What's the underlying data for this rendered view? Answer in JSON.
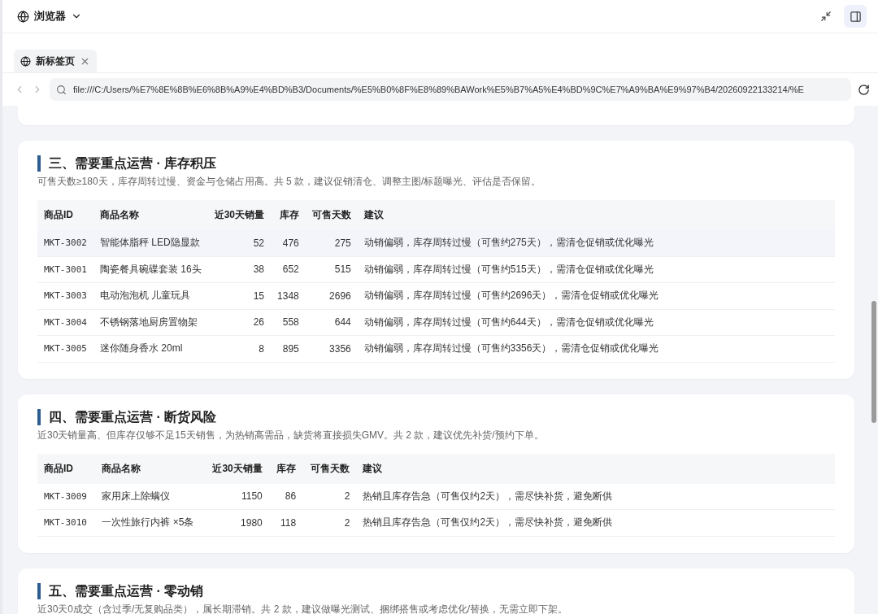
{
  "app": {
    "title": "浏览器"
  },
  "tabs": [
    {
      "label": "新标签页",
      "selected": true
    }
  ],
  "address_bar": {
    "value": "file:///C:/Users/%E7%8E%8B%E6%8B%A9%E4%BD%B3/Documents/%E5%B0%8F%E8%89%BAWork%E5%B7%A5%E4%BD%9C%E7%A9%BA%E9%97%B4/20260922133214/%E"
  },
  "sections": [
    {
      "title": "三、需要重点运营 · 库存积压",
      "description": "可售天数≥180天，库存周转过慢、资金与仓储占用高。共 5 款，建议促销清仓、调整主图/标题曝光、评估是否保留。",
      "columns": [
        "商品ID",
        "商品名称",
        "近30天销量",
        "库存",
        "可售天数",
        "建议"
      ],
      "rows": [
        {
          "cells": [
            "MKT-3002",
            "智能体脂秤 LED隐显款",
            "52",
            "476",
            "275",
            "动销偏弱，库存周转过慢（可售约275天），需清仓促销或优化曝光"
          ],
          "hovered": true
        },
        {
          "cells": [
            "MKT-3001",
            "陶瓷餐具碗碟套装 16头",
            "38",
            "652",
            "515",
            "动销偏弱，库存周转过慢（可售约515天），需清仓促销或优化曝光"
          ],
          "hovered": false
        },
        {
          "cells": [
            "MKT-3003",
            "电动泡泡机 儿童玩具",
            "15",
            "1348",
            "2696",
            "动销偏弱，库存周转过慢（可售约2696天），需清仓促销或优化曝光"
          ],
          "hovered": false
        },
        {
          "cells": [
            "MKT-3004",
            "不锈钢落地厨房置物架",
            "26",
            "558",
            "644",
            "动销偏弱，库存周转过慢（可售约644天），需清仓促销或优化曝光"
          ],
          "hovered": false
        },
        {
          "cells": [
            "MKT-3005",
            "迷你随身香水 20ml",
            "8",
            "895",
            "3356",
            "动销偏弱，库存周转过慢（可售约3356天），需清仓促销或优化曝光"
          ],
          "hovered": false
        }
      ]
    },
    {
      "title": "四、需要重点运营 · 断货风险",
      "description": "近30天销量高、但库存仅够不足15天销售，为热销高需品，缺货将直接损失GMV。共 2 款，建议优先补货/预约下单。",
      "columns": [
        "商品ID",
        "商品名称",
        "近30天销量",
        "库存",
        "可售天数",
        "建议"
      ],
      "rows": [
        {
          "cells": [
            "MKT-3009",
            "家用床上除螨仪",
            "1150",
            "86",
            "2",
            "热销且库存告急（可售仅约2天），需尽快补货，避免断供"
          ],
          "hovered": false
        },
        {
          "cells": [
            "MKT-3010",
            "一次性旅行内裤 ×5条",
            "1980",
            "118",
            "2",
            "热销且库存告急（可售仅约2天），需尽快补货，避免断供"
          ],
          "hovered": false
        }
      ]
    },
    {
      "title": "五、需要重点运营 · 零动销",
      "description": "近30天0成交（含过季/无复购品类），属长期滞销。共 2 款，建议做曝光测试、捆绑搭售或考虑优化/替换，无需立即下架。"
    }
  ]
}
